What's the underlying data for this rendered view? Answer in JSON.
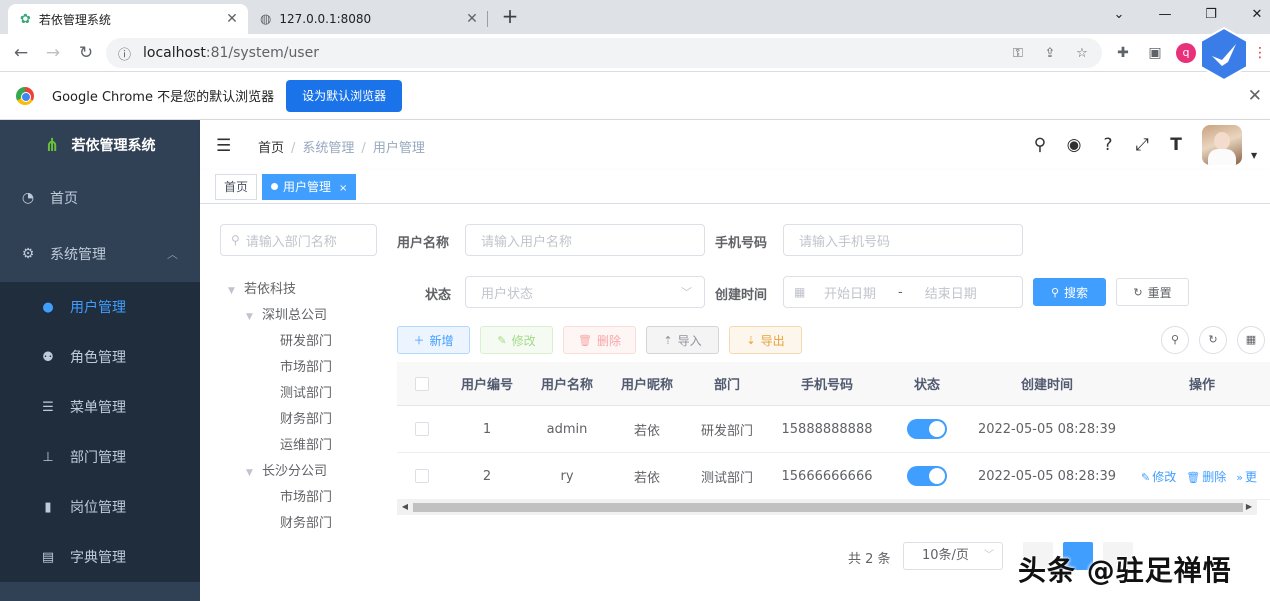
{
  "browser": {
    "tabs": [
      {
        "title": "若依管理系统",
        "close": "✕"
      },
      {
        "title": "127.0.0.1:8080",
        "close": "✕"
      }
    ],
    "new_tab": "+",
    "url_host": "localhost",
    "url_rest": ":81/system/user",
    "profile_initial": "q",
    "window_controls": [
      "⌄",
      "—",
      "❐",
      "✕"
    ]
  },
  "infobar": {
    "message": "Google Chrome 不是您的默认浏览器",
    "button": "设为默认浏览器"
  },
  "sidebar": {
    "title": "若依管理系统",
    "items": [
      {
        "label": "首页",
        "icon": "dashboard-icon"
      },
      {
        "label": "系统管理",
        "icon": "gear-icon"
      }
    ],
    "subitems": [
      {
        "label": "用户管理",
        "icon": "user-icon",
        "active": true
      },
      {
        "label": "角色管理",
        "icon": "peoples-icon"
      },
      {
        "label": "菜单管理",
        "icon": "tree-table-icon"
      },
      {
        "label": "部门管理",
        "icon": "tree-icon"
      },
      {
        "label": "岗位管理",
        "icon": "post-icon"
      },
      {
        "label": "字典管理",
        "icon": "dict-icon"
      }
    ]
  },
  "navbar": {
    "breadcrumb": [
      "首页",
      "系统管理",
      "用户管理"
    ]
  },
  "tags": {
    "home": "首页",
    "active": "用户管理",
    "close": "×"
  },
  "dept": {
    "placeholder": "请输入部门名称",
    "tree": [
      {
        "label": "若依科技",
        "level": 0,
        "expandable": true
      },
      {
        "label": "深圳总公司",
        "level": 1,
        "expandable": true
      },
      {
        "label": "研发部门",
        "level": 2
      },
      {
        "label": "市场部门",
        "level": 2
      },
      {
        "label": "测试部门",
        "level": 2
      },
      {
        "label": "财务部门",
        "level": 2
      },
      {
        "label": "运维部门",
        "level": 2
      },
      {
        "label": "长沙分公司",
        "level": 1,
        "expandable": true
      },
      {
        "label": "市场部门",
        "level": 2
      },
      {
        "label": "财务部门",
        "level": 2
      }
    ]
  },
  "query": {
    "username_label": "用户名称",
    "username_placeholder": "请输入用户名称",
    "phone_label": "手机号码",
    "phone_placeholder": "请输入手机号码",
    "status_label": "状态",
    "status_placeholder": "用户状态",
    "time_label": "创建时间",
    "start_placeholder": "开始日期",
    "range_sep": "-",
    "end_placeholder": "结束日期",
    "search": "搜索",
    "reset": "重置"
  },
  "actions": {
    "add": "新增",
    "edit": "修改",
    "delete": "删除",
    "import": "导入",
    "export": "导出"
  },
  "table": {
    "columns": [
      "用户编号",
      "用户名称",
      "用户昵称",
      "部门",
      "手机号码",
      "状态",
      "创建时间",
      "操作"
    ],
    "rows": [
      {
        "id": "1",
        "name": "admin",
        "nick": "若依",
        "dept": "研发部门",
        "phone": "15888888888",
        "status": true,
        "time": "2022-05-05 08:28:39",
        "ops": []
      },
      {
        "id": "2",
        "name": "ry",
        "nick": "若依",
        "dept": "测试部门",
        "phone": "15666666666",
        "status": true,
        "time": "2022-05-05 08:28:39",
        "ops": [
          "修改",
          "删除",
          "更"
        ]
      }
    ]
  },
  "pagination": {
    "total": "共 2 条",
    "page_size": "10条/页"
  },
  "watermark": "头条 @驻足禅悟",
  "colors": {
    "primary": "#409eff",
    "sidebar_bg": "#304156",
    "submenu_bg": "#1f2d3d"
  }
}
